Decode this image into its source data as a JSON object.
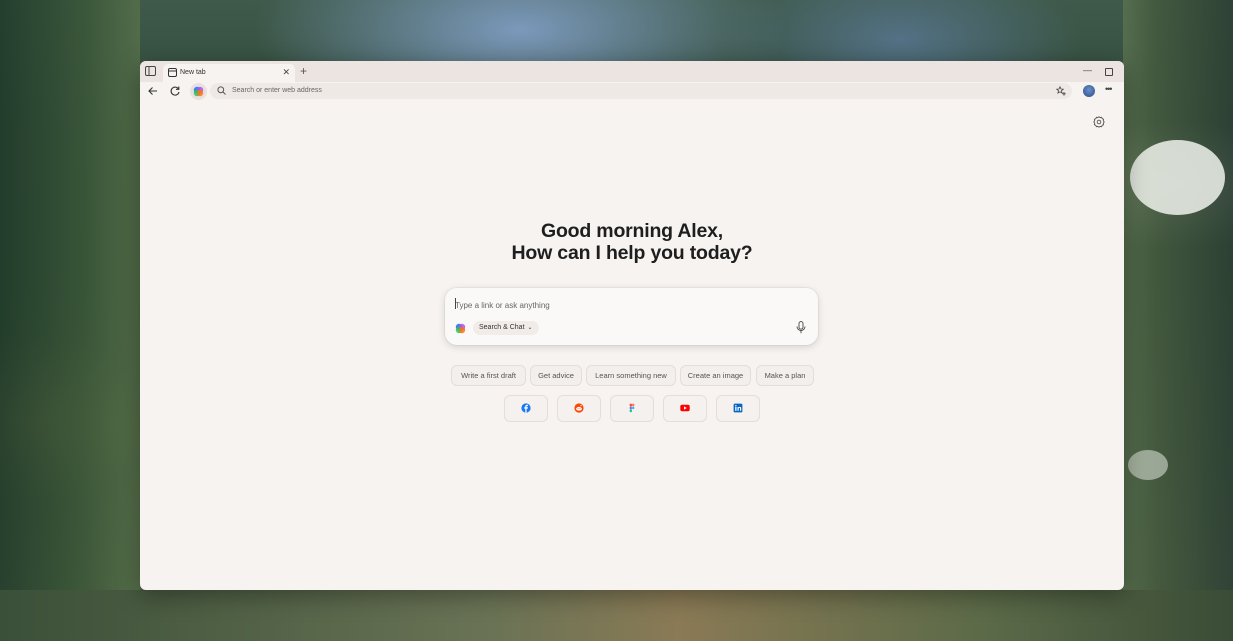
{
  "browser": {
    "tab": {
      "title": "New tab"
    },
    "address_bar": {
      "placeholder": "Search or enter web address"
    }
  },
  "greeting": {
    "line1": "Good morning Alex,",
    "line2": "How can I help you today?"
  },
  "chat": {
    "placeholder": "Type a link or ask anything",
    "mode": "Search & Chat"
  },
  "suggestions": [
    "Write a first draft",
    "Get advice",
    "Learn something new",
    "Create an image",
    "Make a plan"
  ],
  "shortcuts": [
    {
      "icon": "facebook-icon",
      "color": "#1877f2"
    },
    {
      "icon": "reddit-icon",
      "color": "#ff4500"
    },
    {
      "icon": "figma-icon",
      "color": "#f24e1e"
    },
    {
      "icon": "youtube-icon",
      "color": "#ff0000"
    },
    {
      "icon": "linkedin-icon",
      "color": "#0a66c2"
    }
  ],
  "colors": {
    "page_background": "#f7f3f0",
    "tabbar": "#ece4e0",
    "text_primary": "#1e1e1e"
  }
}
